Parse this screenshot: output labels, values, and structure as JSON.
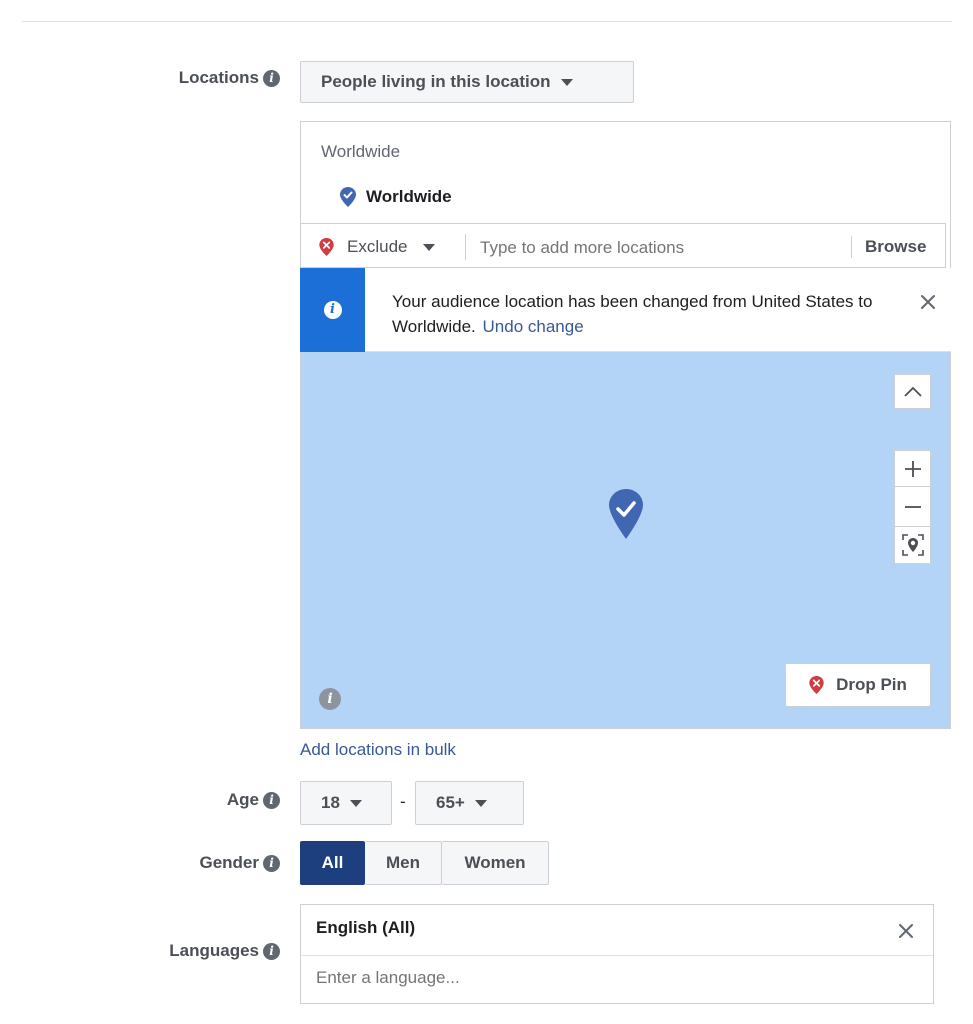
{
  "locations": {
    "label": "Locations",
    "type_dropdown": "People living in this location",
    "group_heading": "Worldwide",
    "selected_location": "Worldwide",
    "exclude_label": "Exclude",
    "search_placeholder": "Type to add more locations",
    "browse_label": "Browse",
    "notice_text": "Your audience location has been changed from United States to Worldwide.",
    "undo_link": "Undo change",
    "drop_pin_label": "Drop Pin",
    "add_bulk_link": "Add locations in bulk"
  },
  "age": {
    "label": "Age",
    "min": "18",
    "separator": "-",
    "max": "65+"
  },
  "gender": {
    "label": "Gender",
    "options": [
      "All",
      "Men",
      "Women"
    ],
    "selected": "All"
  },
  "languages": {
    "label": "Languages",
    "selected": "English (All)",
    "placeholder": "Enter a language..."
  },
  "colors": {
    "map_water": "#b3d4f7",
    "pin_blue": "#4267b2",
    "pin_red": "#d23b3f",
    "notice_bar": "#1c6fd6",
    "selected_segment": "#1d3f7e",
    "link": "#385898"
  },
  "icons": [
    "info-icon",
    "location-pin-icon",
    "exclude-pin-icon",
    "close-icon",
    "chevron-up-icon",
    "zoom-in-icon",
    "zoom-out-icon",
    "recenter-icon"
  ]
}
